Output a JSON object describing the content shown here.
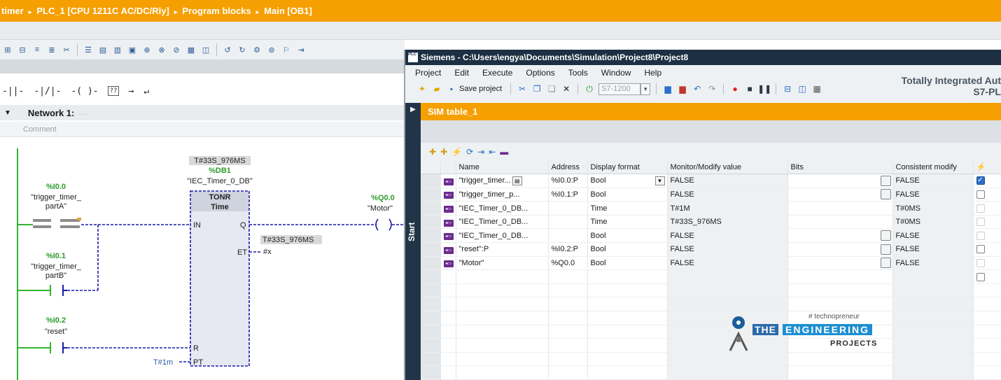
{
  "editor": {
    "breadcrumb": [
      "timer",
      "PLC_1 [CPU 1211C AC/DC/Rly]",
      "Program blocks",
      "Main [OB1]"
    ],
    "breadcrumb_sep": "▸",
    "network_title": "Network 1:",
    "network_dots": ".....",
    "comment_placeholder": "Comment",
    "ladder_icons": [
      "-||-",
      "-|/|-",
      "-( )-",
      "??",
      "→",
      "↵"
    ]
  },
  "ladder": {
    "contact1_addr": "%I0.0",
    "contact1_name1": "\"trigger_timer_",
    "contact1_name2": "partA\"",
    "contact2_addr": "%I0.1",
    "contact2_name1": "\"trigger_timer_",
    "contact2_name2": "partB\"",
    "contact3_addr": "%I0.2",
    "contact3_name": "\"reset\"",
    "timer_value": "T#33S_976MS",
    "timer_db": "%DB1",
    "timer_db_name": "\"IEC_Timer_0_DB\"",
    "timer_type": "TONR",
    "timer_type2": "Time",
    "pin_in": "IN",
    "pin_q": "Q",
    "pin_et": "ET",
    "pin_r": "R",
    "pin_pt": "PT",
    "et_value": "T#33S_976MS",
    "et_var": "#x",
    "pt_value": "T#1m",
    "coil_addr": "%Q0.0",
    "coil_name": "\"Motor\""
  },
  "sim": {
    "title": "Siemens  -  C:\\Users\\engya\\Documents\\Simulation\\Project8\\Project8",
    "logo": "PLC SIM",
    "menu": [
      "Project",
      "Edit",
      "Execute",
      "Options",
      "Tools",
      "Window",
      "Help"
    ],
    "brand_line1": "Totally Integrated Aut",
    "brand_line2": "S7-PL",
    "save_label": "Save project",
    "cpu_select": "S7-1200",
    "side_label": "Start",
    "tab_label": "SIM table_1",
    "columns": [
      "",
      "",
      "Name",
      "Address",
      "Display format",
      "Monitor/Modify value",
      "Bits",
      "Consistent modify",
      "⚡"
    ],
    "rows": [
      {
        "name": "\"trigger_timer...",
        "address": "%I0.0:P",
        "format": "Bool",
        "value": "FALSE",
        "bits": true,
        "consistent": "FALSE",
        "check": "checked",
        "format_dd": true,
        "name_btn": true
      },
      {
        "name": "\"trigger_timer_p...",
        "address": "%I0.1:P",
        "format": "Bool",
        "value": "FALSE",
        "bits": true,
        "consistent": "FALSE",
        "check": "empty"
      },
      {
        "name": "\"IEC_Timer_0_DB...",
        "address": "",
        "format": "Time",
        "value": "T#1M",
        "bits": false,
        "consistent": "T#0MS",
        "check": "dim"
      },
      {
        "name": "\"IEC_Timer_0_DB...",
        "address": "",
        "format": "Time",
        "value": "T#33S_976MS",
        "bits": false,
        "consistent": "T#0MS",
        "check": "dim"
      },
      {
        "name": "\"IEC_Timer_0_DB...",
        "address": "",
        "format": "Bool",
        "value": "FALSE",
        "bits": true,
        "consistent": "FALSE",
        "check": "dim"
      },
      {
        "name": "\"reset\":P",
        "address": "%I0.2:P",
        "format": "Bool",
        "value": "FALSE",
        "bits": true,
        "consistent": "FALSE",
        "check": "empty"
      },
      {
        "name": "\"Motor\"",
        "address": "%Q0.0",
        "format": "Bool",
        "value": "FALSE",
        "bits": true,
        "consistent": "FALSE",
        "check": "dim"
      }
    ]
  },
  "watermark": {
    "tag": "# technopreneur",
    "the": "THE",
    "engineering": "ENGINEERING",
    "projects": "PROJECTS"
  },
  "colors": {
    "accent_orange": "#f59f00",
    "sim_title_bg": "#1d2f42",
    "wire_blue": "#1a1aa8",
    "rail_green": "#32b432"
  }
}
